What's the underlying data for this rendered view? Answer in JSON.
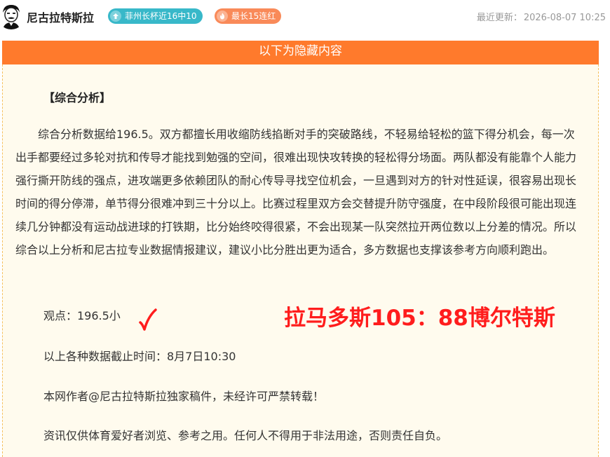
{
  "header": {
    "author_name": "尼古拉特斯拉",
    "badge_streak_label": "菲州长杯近16中10",
    "badge_hot_label": "最长15连红",
    "updated_label": "最近更新：",
    "updated_time": "2026-08-07 10:25"
  },
  "article": {
    "hidden_banner": "以下为隐藏内容",
    "section_title": "【综合分析】",
    "analysis_paragraph": "综合分析数据给196.5。双方都擅长用收缩防线掐断对手的突破路线，不轻易给轻松的篮下得分机会，每一次出手都要经过多轮对抗和传导才能找到勉强的空间，很难出现快攻转换的轻松得分场面。两队都没有能靠个人能力强行撕开防线的强点，进攻端更多依赖团队的耐心传导寻找空位机会，一旦遇到对方的针对性延误，很容易出现长时间的得分停滞，单节得分很难冲到三十分以上。比赛过程里双方会交替提升防守强度，在中段阶段很可能出现连续几分钟都没有运动战进球的打铁期，比分始终咬得很紧，不会出现某一队突然拉开两位数以上分差的情况。所以综合以上分析和尼古拉专业数据情报建议，建议小比分胜出更为适合，多方数据也支撑该参考方向顺利跑出。",
    "viewpoint": "观点：196.5小",
    "final_score": "拉马多斯105：88博尔特斯",
    "cutoff": "以上各种数据截止时间：8月7日10:30",
    "copyright": "本网作者@尼古拉特斯拉独家稿件，未经许可严禁转载！",
    "disclaimer": "资讯仅供体育爱好者浏览、参考之用。任何人不得用于非法用途，否则责任自负。"
  },
  "colors": {
    "banner_orange": "#ff7a2c",
    "badge_teal": "#38b8c9",
    "badge_orange": "#f98a59",
    "score_red": "#ff1d1d",
    "check_red": "#ff1d1d",
    "content_bg": "#fffbee"
  },
  "icons": {
    "avatar": "tesla-portrait-avatar",
    "badge_streak": "up-arrow-icon",
    "badge_hot": "flame-icon",
    "result": "check-mark-icon"
  }
}
